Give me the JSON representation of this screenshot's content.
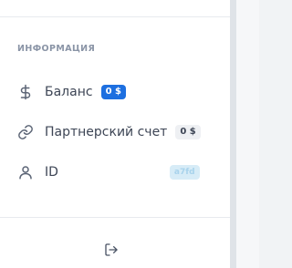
{
  "section": {
    "title": "ИНФОРМАЦИЯ"
  },
  "menu": [
    {
      "label": "Баланс",
      "badge": "0 $",
      "icon": "dollar-icon"
    },
    {
      "label": "Партнерский счет",
      "badge": "0 $",
      "icon": "link-icon"
    },
    {
      "label": "ID",
      "badge": "a7fd",
      "icon": "user-icon"
    }
  ],
  "footer": {
    "logout_icon": "logout-icon"
  },
  "colors": {
    "accent": "#1d6fe0",
    "text": "#3d4555",
    "muted": "#8a94a6"
  }
}
